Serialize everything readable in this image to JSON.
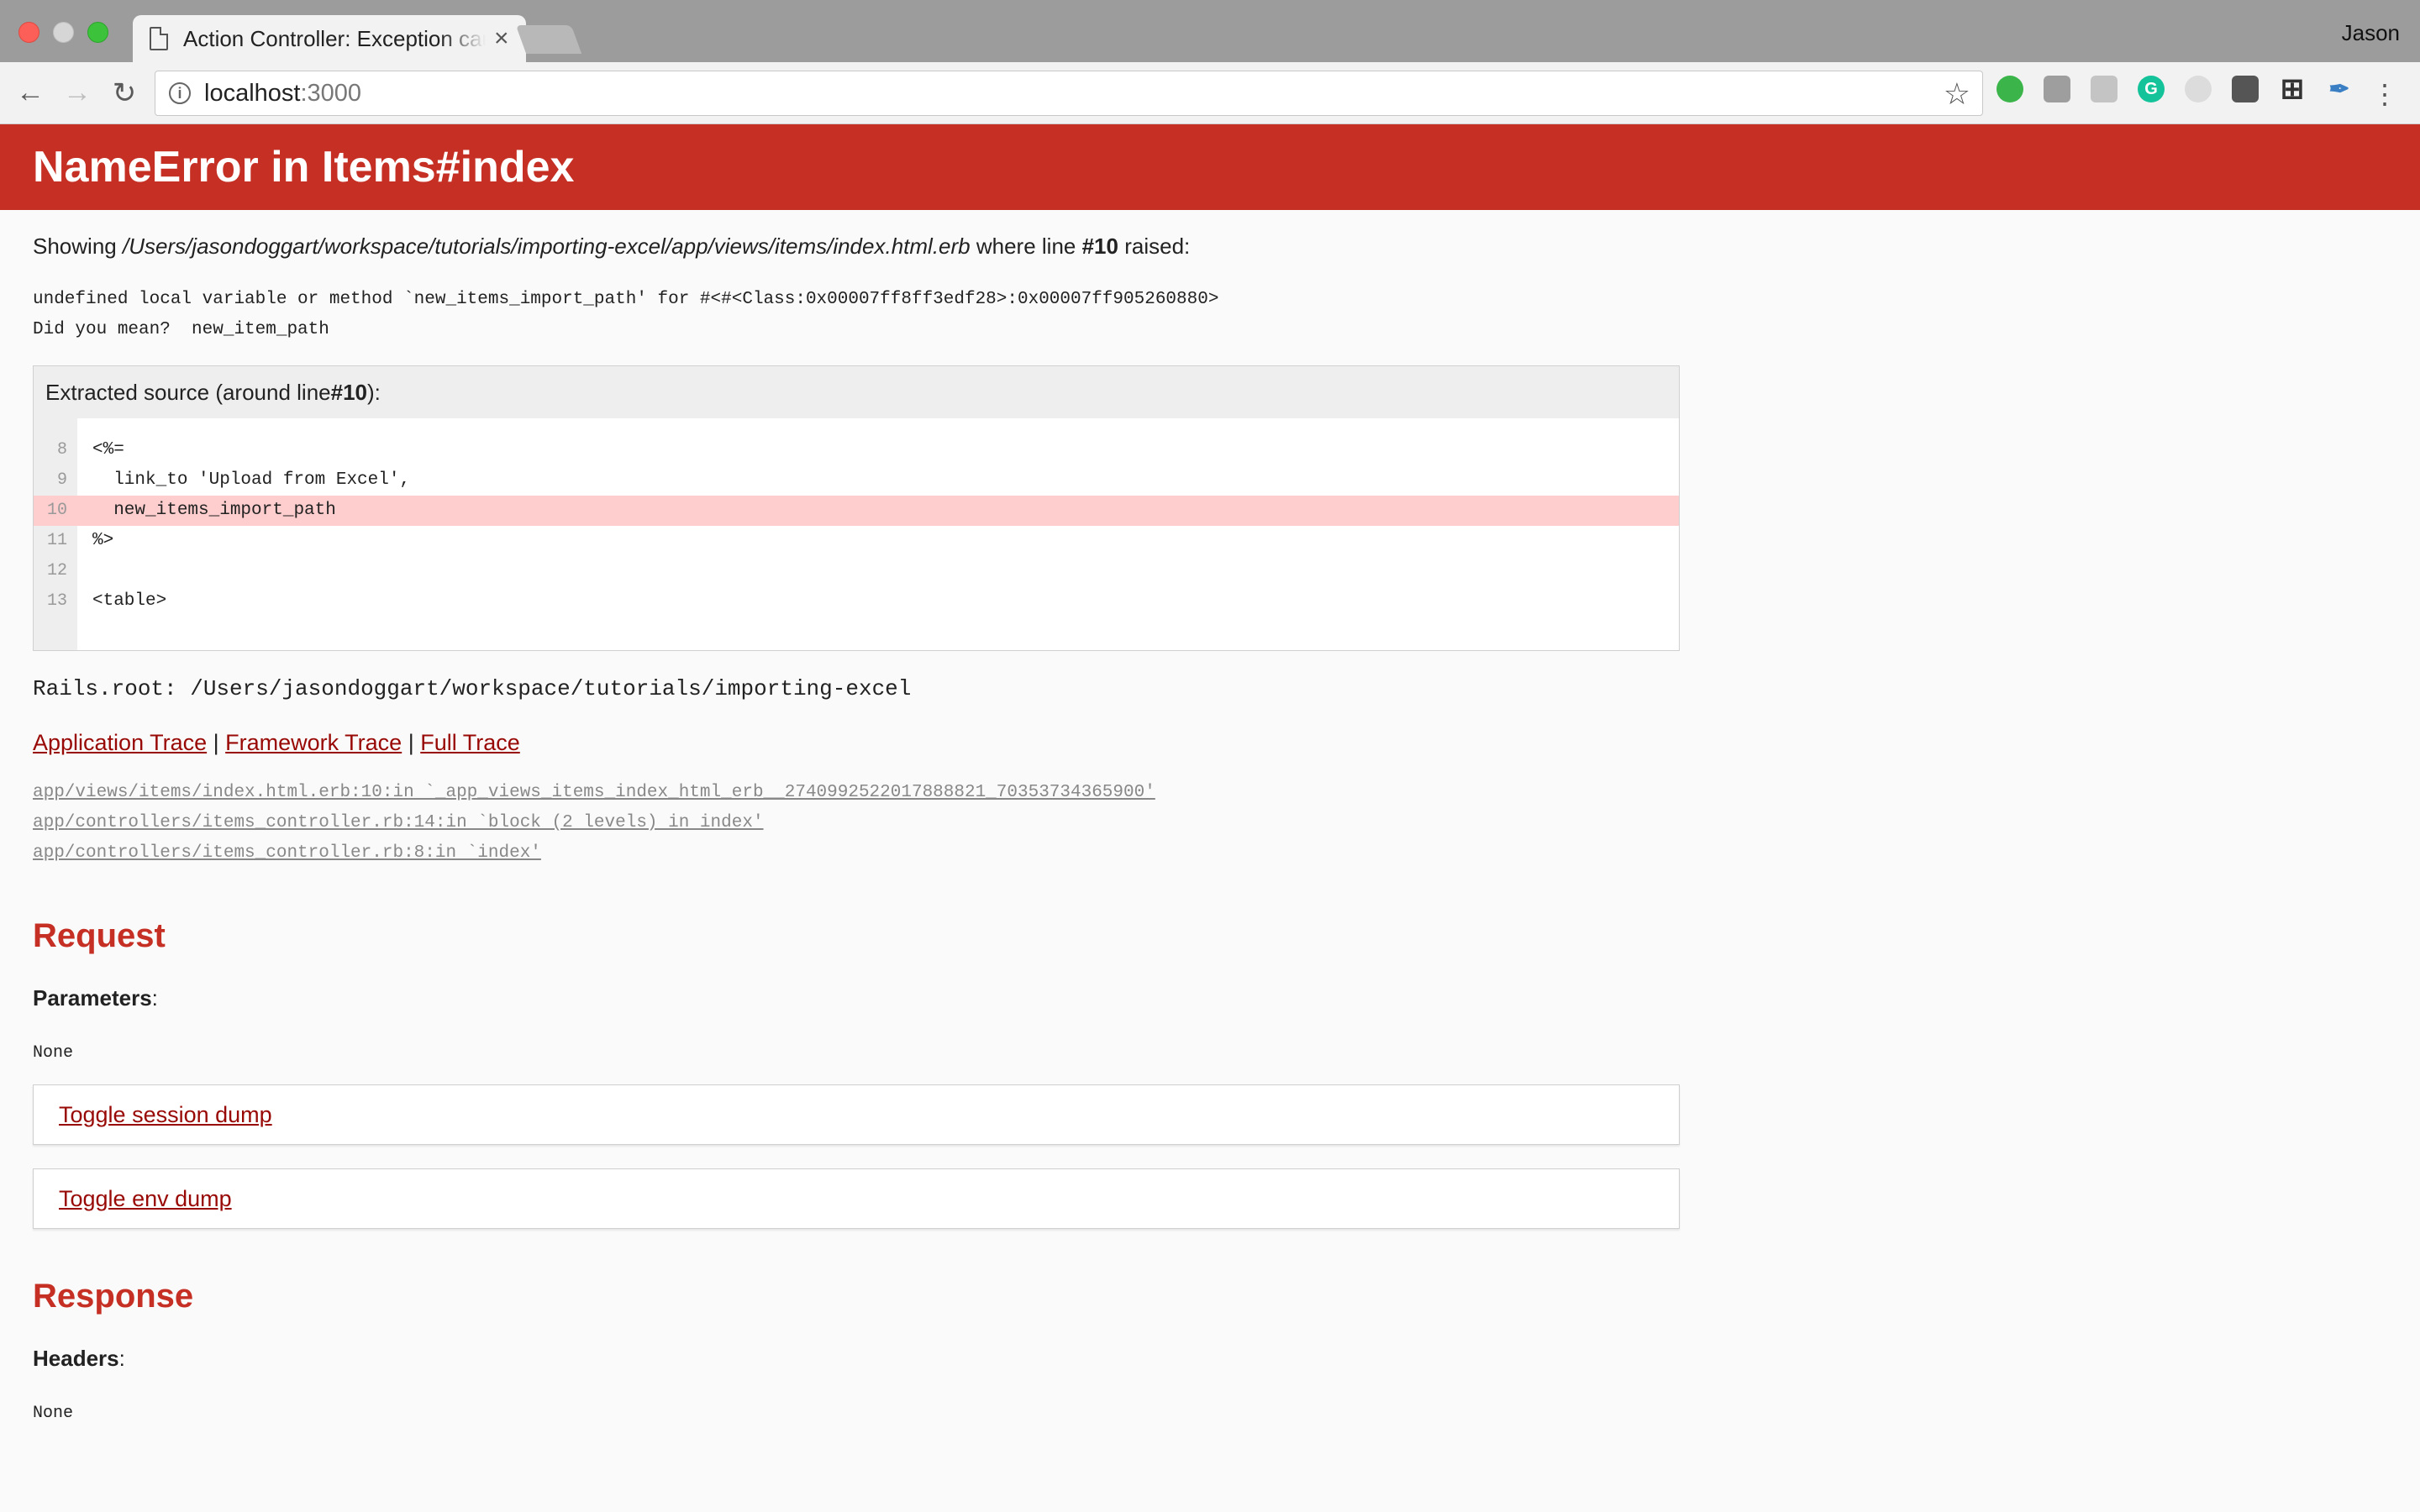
{
  "browser": {
    "tab_title": "Action Controller: Exception caught",
    "tab_close": "×",
    "profile_name": "Jason",
    "url_host": "localhost",
    "url_port": ":3000",
    "icons": {
      "back": "back-arrow-icon",
      "forward": "forward-arrow-icon",
      "reload": "reload-icon",
      "info": "info-icon",
      "star": "star-icon",
      "menu": "menu-dots-icon"
    }
  },
  "error": {
    "title": "NameError in Items#index",
    "showing_prefix": "Showing ",
    "template_path": "/Users/jasondoggart/workspace/tutorials/importing-excel/app/views/items/index.html.erb",
    "where_line_text": " where line ",
    "line_ref": "#10",
    "raised_text": " raised:",
    "message_line1": "undefined local variable or method `new_items_import_path' for #<#<Class:0x00007ff8ff3edf28>:0x00007ff905260880>",
    "message_line2": "Did you mean?  new_item_path"
  },
  "source": {
    "title_prefix": "Extracted source (around line ",
    "title_line": "#10",
    "title_suffix": "):",
    "lines": [
      {
        "num": "8",
        "code": "<%="
      },
      {
        "num": "9",
        "code": "  link_to 'Upload from Excel',"
      },
      {
        "num": "10",
        "code": "  new_items_import_path"
      },
      {
        "num": "11",
        "code": "%>"
      },
      {
        "num": "12",
        "code": ""
      },
      {
        "num": "13",
        "code": "<table>"
      }
    ]
  },
  "rails_root": "Rails.root: /Users/jasondoggart/workspace/tutorials/importing-excel",
  "trace": {
    "application": "Application Trace",
    "framework": "Framework Trace",
    "full": "Full Trace",
    "separator": " | ",
    "entries": [
      "app/views/items/index.html.erb:10:in `_app_views_items_index_html_erb__2740992522017888821_70353734365900'",
      "app/controllers/items_controller.rb:14:in `block (2 levels) in index'",
      "app/controllers/items_controller.rb:8:in `index'"
    ]
  },
  "request": {
    "heading": "Request",
    "parameters_label": "Parameters",
    "parameters_value": "None",
    "toggle_session": "Toggle session dump",
    "toggle_env": "Toggle env dump"
  },
  "response": {
    "heading": "Response",
    "headers_label": "Headers",
    "headers_value": "None"
  },
  "colors": {
    "header_red": "#c52f24",
    "link_red": "#980905",
    "highlight": "#fecdcd"
  }
}
